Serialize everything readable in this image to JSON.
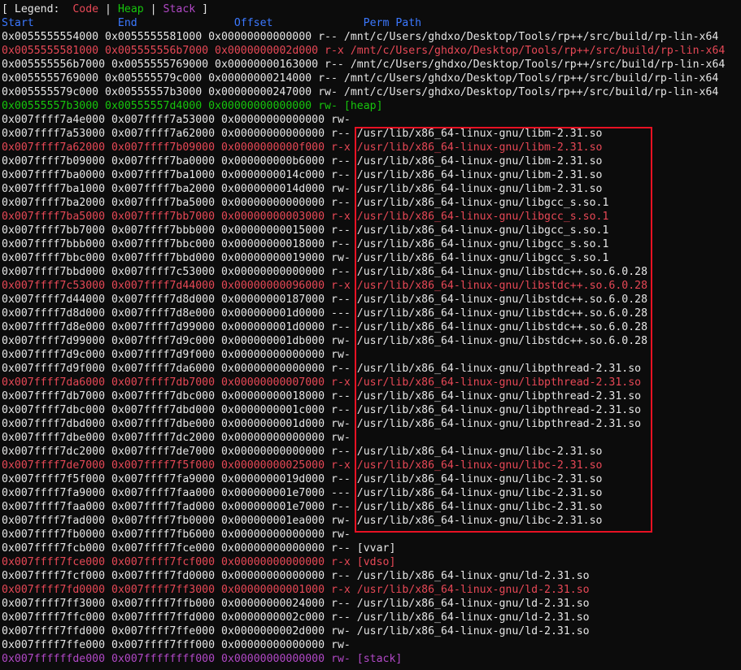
{
  "legend": {
    "open": "[ Legend:  ",
    "code": "Code",
    "sep1": " | ",
    "heap": "Heap",
    "sep2": " | ",
    "stack": "Stack",
    "close": " ]"
  },
  "header": {
    "start": "Start",
    "end": "End",
    "offset": "Offset",
    "perm": "Perm",
    "path": "Path"
  },
  "colors": {
    "code": "#e74856",
    "heap": "#16c60c",
    "stack": "#b148c6",
    "header": "#3b78ff",
    "normal": "#e6e6e6",
    "highlight": "#e81123"
  },
  "rows": [
    {
      "start": "0x0055555554000",
      "end": "0x0055555581000",
      "offset": "0x00000000000000",
      "perm": "r--",
      "path": "/mnt/c/Users/ghdxo/Desktop/Tools/rp++/src/build/rp-lin-x64",
      "type": "normal"
    },
    {
      "start": "0x0055555581000",
      "end": "0x005555556b7000",
      "offset": "0x0000000002d000",
      "perm": "r-x",
      "path": "/mnt/c/Users/ghdxo/Desktop/Tools/rp++/src/build/rp-lin-x64",
      "type": "code"
    },
    {
      "start": "0x005555556b7000",
      "end": "0x0055555769000",
      "offset": "0x00000000163000",
      "perm": "r--",
      "path": "/mnt/c/Users/ghdxo/Desktop/Tools/rp++/src/build/rp-lin-x64",
      "type": "normal"
    },
    {
      "start": "0x0055555769000",
      "end": "0x005555579c000",
      "offset": "0x00000000214000",
      "perm": "r--",
      "path": "/mnt/c/Users/ghdxo/Desktop/Tools/rp++/src/build/rp-lin-x64",
      "type": "normal"
    },
    {
      "start": "0x005555579c000",
      "end": "0x00555557b3000",
      "offset": "0x00000000247000",
      "perm": "rw-",
      "path": "/mnt/c/Users/ghdxo/Desktop/Tools/rp++/src/build/rp-lin-x64",
      "type": "normal"
    },
    {
      "start": "0x00555557b3000",
      "end": "0x00555557d4000",
      "offset": "0x00000000000000",
      "perm": "rw-",
      "path": "[heap]",
      "type": "heap"
    },
    {
      "start": "0x007ffff7a4e000",
      "end": "0x007ffff7a53000",
      "offset": "0x00000000000000",
      "perm": "rw-",
      "path": "",
      "type": "normal"
    },
    {
      "start": "0x007ffff7a53000",
      "end": "0x007ffff7a62000",
      "offset": "0x00000000000000",
      "perm": "r--",
      "path": "/usr/lib/x86_64-linux-gnu/libm-2.31.so",
      "type": "normal"
    },
    {
      "start": "0x007ffff7a62000",
      "end": "0x007ffff7b09000",
      "offset": "0x0000000000f000",
      "perm": "r-x",
      "path": "/usr/lib/x86_64-linux-gnu/libm-2.31.so",
      "type": "code"
    },
    {
      "start": "0x007ffff7b09000",
      "end": "0x007ffff7ba0000",
      "offset": "0x000000000b6000",
      "perm": "r--",
      "path": "/usr/lib/x86_64-linux-gnu/libm-2.31.so",
      "type": "normal"
    },
    {
      "start": "0x007ffff7ba0000",
      "end": "0x007ffff7ba1000",
      "offset": "0x0000000014c000",
      "perm": "r--",
      "path": "/usr/lib/x86_64-linux-gnu/libm-2.31.so",
      "type": "normal"
    },
    {
      "start": "0x007ffff7ba1000",
      "end": "0x007ffff7ba2000",
      "offset": "0x0000000014d000",
      "perm": "rw-",
      "path": "/usr/lib/x86_64-linux-gnu/libm-2.31.so",
      "type": "normal"
    },
    {
      "start": "0x007ffff7ba2000",
      "end": "0x007ffff7ba5000",
      "offset": "0x00000000000000",
      "perm": "r--",
      "path": "/usr/lib/x86_64-linux-gnu/libgcc_s.so.1",
      "type": "normal"
    },
    {
      "start": "0x007ffff7ba5000",
      "end": "0x007ffff7bb7000",
      "offset": "0x00000000003000",
      "perm": "r-x",
      "path": "/usr/lib/x86_64-linux-gnu/libgcc_s.so.1",
      "type": "code"
    },
    {
      "start": "0x007ffff7bb7000",
      "end": "0x007ffff7bbb000",
      "offset": "0x00000000015000",
      "perm": "r--",
      "path": "/usr/lib/x86_64-linux-gnu/libgcc_s.so.1",
      "type": "normal"
    },
    {
      "start": "0x007ffff7bbb000",
      "end": "0x007ffff7bbc000",
      "offset": "0x00000000018000",
      "perm": "r--",
      "path": "/usr/lib/x86_64-linux-gnu/libgcc_s.so.1",
      "type": "normal"
    },
    {
      "start": "0x007ffff7bbc000",
      "end": "0x007ffff7bbd000",
      "offset": "0x00000000019000",
      "perm": "rw-",
      "path": "/usr/lib/x86_64-linux-gnu/libgcc_s.so.1",
      "type": "normal"
    },
    {
      "start": "0x007ffff7bbd000",
      "end": "0x007ffff7c53000",
      "offset": "0x00000000000000",
      "perm": "r--",
      "path": "/usr/lib/x86_64-linux-gnu/libstdc++.so.6.0.28",
      "type": "normal"
    },
    {
      "start": "0x007ffff7c53000",
      "end": "0x007ffff7d44000",
      "offset": "0x00000000096000",
      "perm": "r-x",
      "path": "/usr/lib/x86_64-linux-gnu/libstdc++.so.6.0.28",
      "type": "code"
    },
    {
      "start": "0x007ffff7d44000",
      "end": "0x007ffff7d8d000",
      "offset": "0x00000000187000",
      "perm": "r--",
      "path": "/usr/lib/x86_64-linux-gnu/libstdc++.so.6.0.28",
      "type": "normal"
    },
    {
      "start": "0x007ffff7d8d000",
      "end": "0x007ffff7d8e000",
      "offset": "0x000000001d0000",
      "perm": "---",
      "path": "/usr/lib/x86_64-linux-gnu/libstdc++.so.6.0.28",
      "type": "normal"
    },
    {
      "start": "0x007ffff7d8e000",
      "end": "0x007ffff7d99000",
      "offset": "0x000000001d0000",
      "perm": "r--",
      "path": "/usr/lib/x86_64-linux-gnu/libstdc++.so.6.0.28",
      "type": "normal"
    },
    {
      "start": "0x007ffff7d99000",
      "end": "0x007ffff7d9c000",
      "offset": "0x000000001db000",
      "perm": "rw-",
      "path": "/usr/lib/x86_64-linux-gnu/libstdc++.so.6.0.28",
      "type": "normal"
    },
    {
      "start": "0x007ffff7d9c000",
      "end": "0x007ffff7d9f000",
      "offset": "0x00000000000000",
      "perm": "rw-",
      "path": "",
      "type": "normal"
    },
    {
      "start": "0x007ffff7d9f000",
      "end": "0x007ffff7da6000",
      "offset": "0x00000000000000",
      "perm": "r--",
      "path": "/usr/lib/x86_64-linux-gnu/libpthread-2.31.so",
      "type": "normal"
    },
    {
      "start": "0x007ffff7da6000",
      "end": "0x007ffff7db7000",
      "offset": "0x00000000007000",
      "perm": "r-x",
      "path": "/usr/lib/x86_64-linux-gnu/libpthread-2.31.so",
      "type": "code"
    },
    {
      "start": "0x007ffff7db7000",
      "end": "0x007ffff7dbc000",
      "offset": "0x00000000018000",
      "perm": "r--",
      "path": "/usr/lib/x86_64-linux-gnu/libpthread-2.31.so",
      "type": "normal"
    },
    {
      "start": "0x007ffff7dbc000",
      "end": "0x007ffff7dbd000",
      "offset": "0x0000000001c000",
      "perm": "r--",
      "path": "/usr/lib/x86_64-linux-gnu/libpthread-2.31.so",
      "type": "normal"
    },
    {
      "start": "0x007ffff7dbd000",
      "end": "0x007ffff7dbe000",
      "offset": "0x0000000001d000",
      "perm": "rw-",
      "path": "/usr/lib/x86_64-linux-gnu/libpthread-2.31.so",
      "type": "normal"
    },
    {
      "start": "0x007ffff7dbe000",
      "end": "0x007ffff7dc2000",
      "offset": "0x00000000000000",
      "perm": "rw-",
      "path": "",
      "type": "normal"
    },
    {
      "start": "0x007ffff7dc2000",
      "end": "0x007ffff7de7000",
      "offset": "0x00000000000000",
      "perm": "r--",
      "path": "/usr/lib/x86_64-linux-gnu/libc-2.31.so",
      "type": "normal"
    },
    {
      "start": "0x007ffff7de7000",
      "end": "0x007ffff7f5f000",
      "offset": "0x00000000025000",
      "perm": "r-x",
      "path": "/usr/lib/x86_64-linux-gnu/libc-2.31.so",
      "type": "code"
    },
    {
      "start": "0x007ffff7f5f000",
      "end": "0x007ffff7fa9000",
      "offset": "0x0000000019d000",
      "perm": "r--",
      "path": "/usr/lib/x86_64-linux-gnu/libc-2.31.so",
      "type": "normal"
    },
    {
      "start": "0x007ffff7fa9000",
      "end": "0x007ffff7faa000",
      "offset": "0x000000001e7000",
      "perm": "---",
      "path": "/usr/lib/x86_64-linux-gnu/libc-2.31.so",
      "type": "normal"
    },
    {
      "start": "0x007ffff7faa000",
      "end": "0x007ffff7fad000",
      "offset": "0x000000001e7000",
      "perm": "r--",
      "path": "/usr/lib/x86_64-linux-gnu/libc-2.31.so",
      "type": "normal"
    },
    {
      "start": "0x007ffff7fad000",
      "end": "0x007ffff7fb0000",
      "offset": "0x000000001ea000",
      "perm": "rw-",
      "path": "/usr/lib/x86_64-linux-gnu/libc-2.31.so",
      "type": "normal"
    },
    {
      "start": "0x007ffff7fb0000",
      "end": "0x007ffff7fb6000",
      "offset": "0x00000000000000",
      "perm": "rw-",
      "path": "",
      "type": "normal"
    },
    {
      "start": "0x007ffff7fcb000",
      "end": "0x007ffff7fce000",
      "offset": "0x00000000000000",
      "perm": "r--",
      "path": "[vvar]",
      "type": "normal"
    },
    {
      "start": "0x007ffff7fce000",
      "end": "0x007ffff7fcf000",
      "offset": "0x00000000000000",
      "perm": "r-x",
      "path": "[vdso]",
      "type": "code"
    },
    {
      "start": "0x007ffff7fcf000",
      "end": "0x007ffff7fd0000",
      "offset": "0x00000000000000",
      "perm": "r--",
      "path": "/usr/lib/x86_64-linux-gnu/ld-2.31.so",
      "type": "normal"
    },
    {
      "start": "0x007ffff7fd0000",
      "end": "0x007ffff7ff3000",
      "offset": "0x00000000001000",
      "perm": "r-x",
      "path": "/usr/lib/x86_64-linux-gnu/ld-2.31.so",
      "type": "code"
    },
    {
      "start": "0x007ffff7ff3000",
      "end": "0x007ffff7ffb000",
      "offset": "0x00000000024000",
      "perm": "r--",
      "path": "/usr/lib/x86_64-linux-gnu/ld-2.31.so",
      "type": "normal"
    },
    {
      "start": "0x007ffff7ffc000",
      "end": "0x007ffff7ffd000",
      "offset": "0x0000000002c000",
      "perm": "r--",
      "path": "/usr/lib/x86_64-linux-gnu/ld-2.31.so",
      "type": "normal"
    },
    {
      "start": "0x007ffff7ffd000",
      "end": "0x007ffff7ffe000",
      "offset": "0x0000000002d000",
      "perm": "rw-",
      "path": "/usr/lib/x86_64-linux-gnu/ld-2.31.so",
      "type": "normal"
    },
    {
      "start": "0x007ffff7ffe000",
      "end": "0x007ffff7fff000",
      "offset": "0x00000000000000",
      "perm": "rw-",
      "path": "",
      "type": "normal"
    },
    {
      "start": "0x007ffffffde000",
      "end": "0x007ffffffff000",
      "offset": "0x00000000000000",
      "perm": "rw-",
      "path": "[stack]",
      "type": "stack"
    }
  ]
}
